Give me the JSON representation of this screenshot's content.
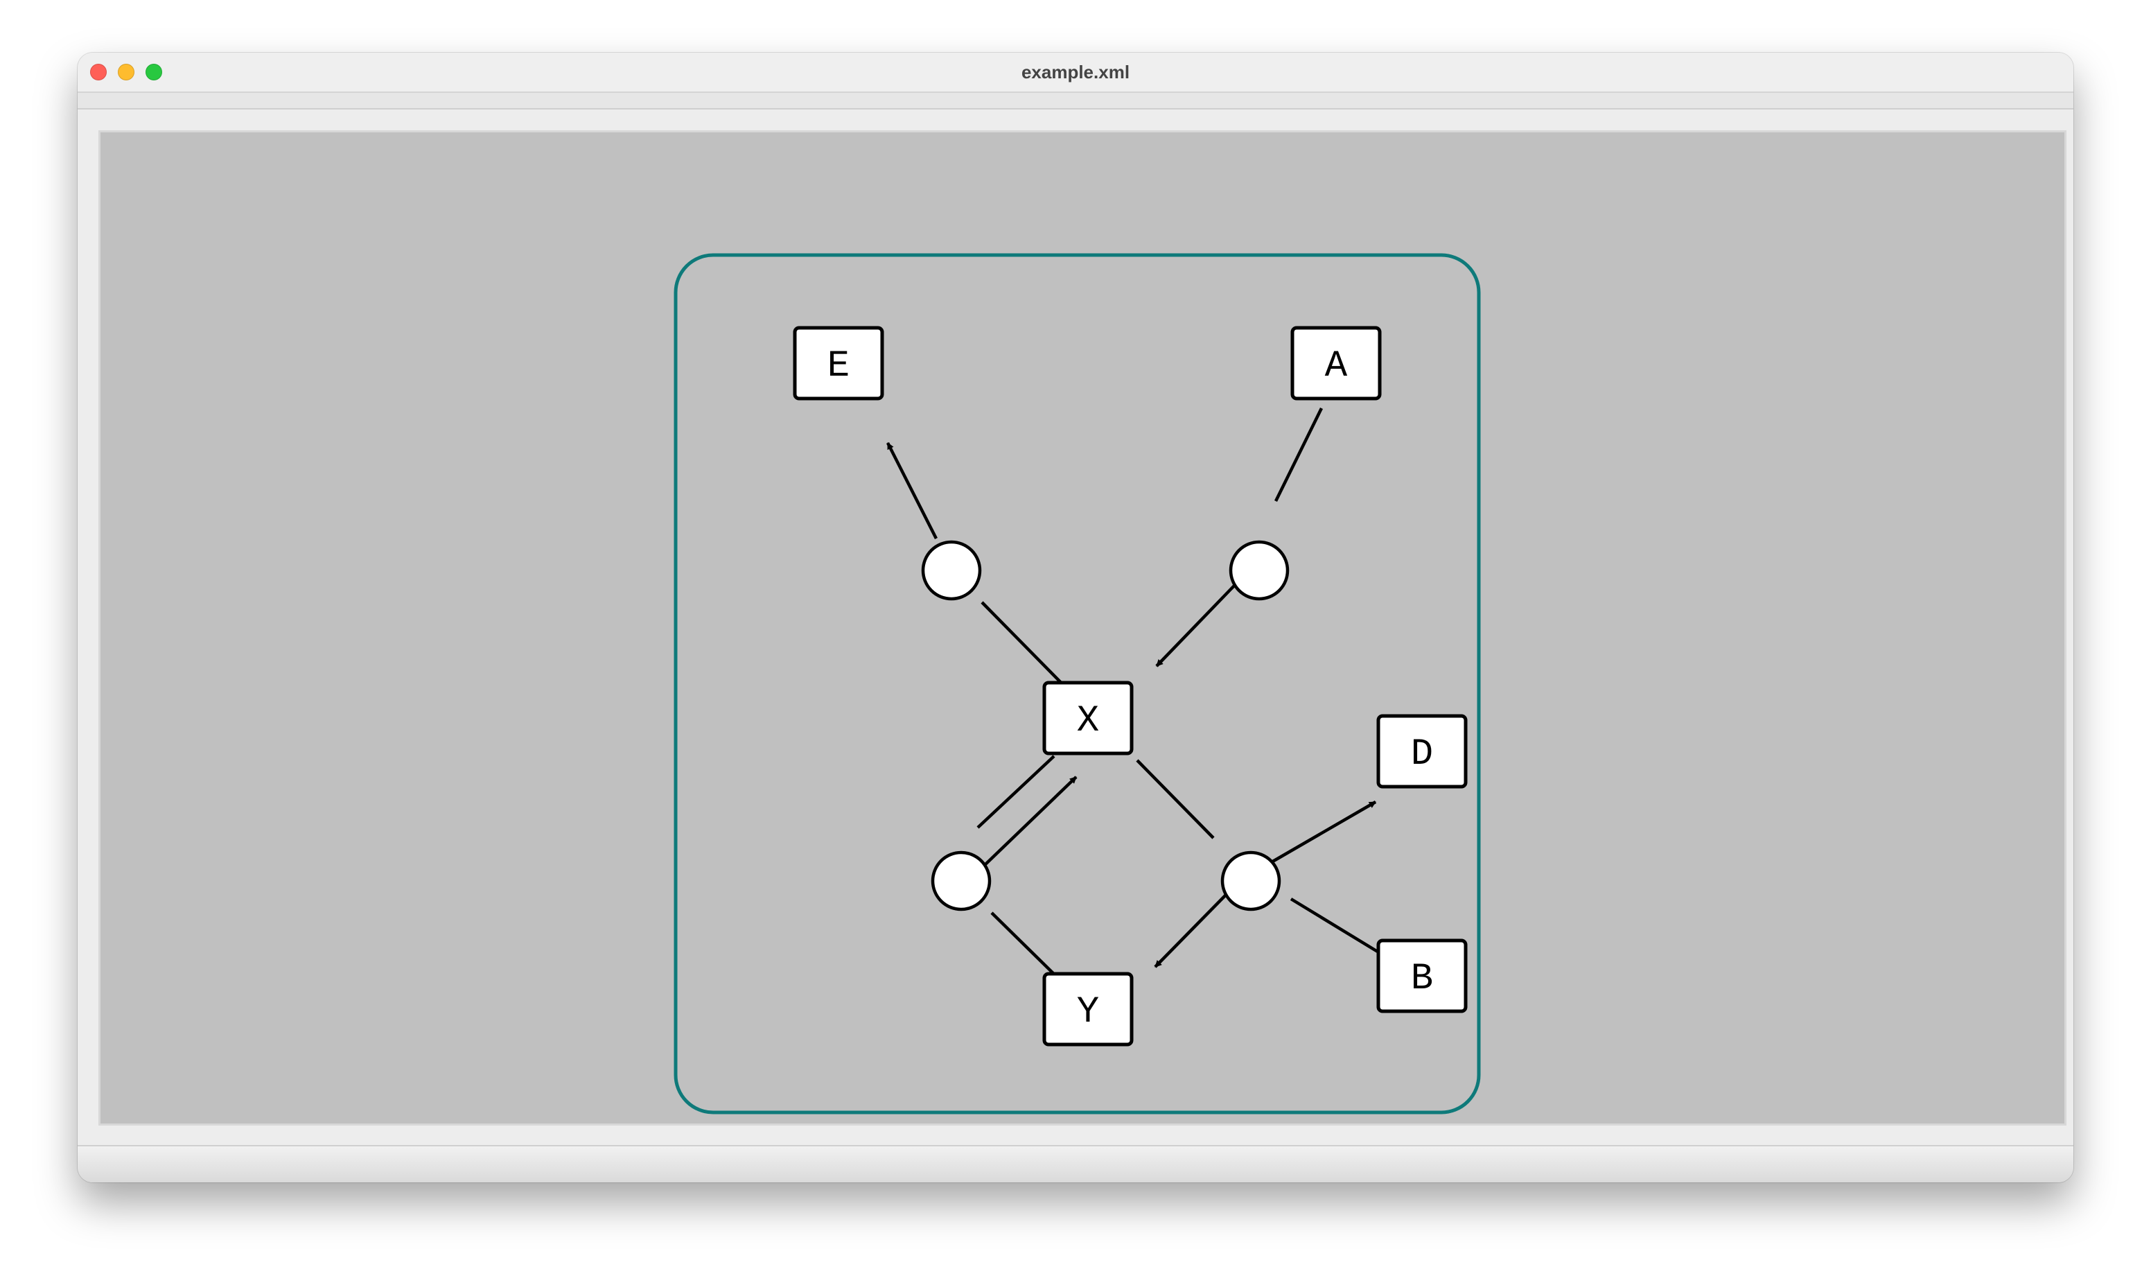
{
  "window": {
    "title": "example.xml"
  },
  "colors": {
    "canvas_background": "#c0c0c0",
    "compartment_stroke": "#0e7a7a",
    "node_fill": "#ffffff",
    "node_stroke": "#000000",
    "close_button": "#ff5f57",
    "minimize_button": "#febc2e",
    "maximize_button": "#28c840"
  },
  "diagram": {
    "compartment": {
      "label": "compartment"
    },
    "species": [
      {
        "id": "E",
        "label": "E"
      },
      {
        "id": "A",
        "label": "A"
      },
      {
        "id": "X",
        "label": "X"
      },
      {
        "id": "D",
        "label": "D"
      },
      {
        "id": "B",
        "label": "B"
      },
      {
        "id": "Y",
        "label": "Y"
      }
    ],
    "reactions": [
      {
        "id": "r1",
        "reactants": [
          "X"
        ],
        "products": [
          "E"
        ]
      },
      {
        "id": "r2",
        "reactants": [
          "A"
        ],
        "products": [
          "X"
        ]
      },
      {
        "id": "r3",
        "reactants": [
          "Y"
        ],
        "products": [
          "X"
        ],
        "modifiers": [
          "X"
        ]
      },
      {
        "id": "r4",
        "reactants": [
          "X",
          "B"
        ],
        "products": [
          "Y",
          "D"
        ]
      }
    ]
  }
}
